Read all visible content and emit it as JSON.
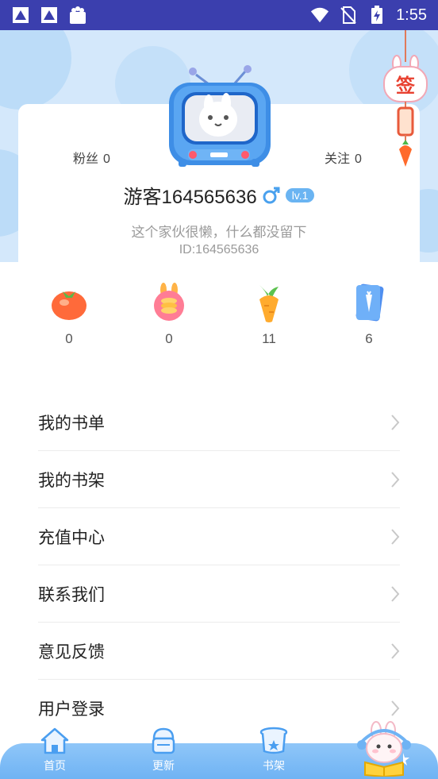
{
  "status_bar": {
    "time": "1:55",
    "left_icons": [
      "app-notification-icon",
      "app-notification-icon",
      "shopping-bag-icon"
    ],
    "right_icons": [
      "wifi-icon",
      "no-sim-icon",
      "battery-charging-icon"
    ]
  },
  "profile": {
    "fans_label": "粉丝",
    "fans_count": "0",
    "follow_label": "关注",
    "follow_count": "0",
    "username": "游客164565636",
    "gender": "male",
    "level": "lv.1",
    "bio": "这个家伙很懒，什么都没留下",
    "user_id": "ID:164565636"
  },
  "sign_in": {
    "label": "签"
  },
  "stats": [
    {
      "icon": "tomato-icon",
      "value": "0"
    },
    {
      "icon": "coin-bunny-icon",
      "value": "0"
    },
    {
      "icon": "carrot-icon",
      "value": "11"
    },
    {
      "icon": "carrot-card-icon",
      "value": "6"
    }
  ],
  "menu": [
    {
      "label": "我的书单"
    },
    {
      "label": "我的书架"
    },
    {
      "label": "充值中心"
    },
    {
      "label": "联系我们"
    },
    {
      "label": "意见反馈"
    },
    {
      "label": "用户登录"
    }
  ],
  "bottom_nav": [
    {
      "label": "首页",
      "icon": "home-icon"
    },
    {
      "label": "更新",
      "icon": "update-icon"
    },
    {
      "label": "书架",
      "icon": "bookshelf-icon"
    },
    {
      "label": "",
      "icon": "bunny-reading-icon"
    }
  ],
  "colors": {
    "status_bar": "#3b3fae",
    "hero_bg": "#d4e8fb",
    "accent": "#6ab4f2",
    "nav_bg": "#7fbcf6"
  }
}
